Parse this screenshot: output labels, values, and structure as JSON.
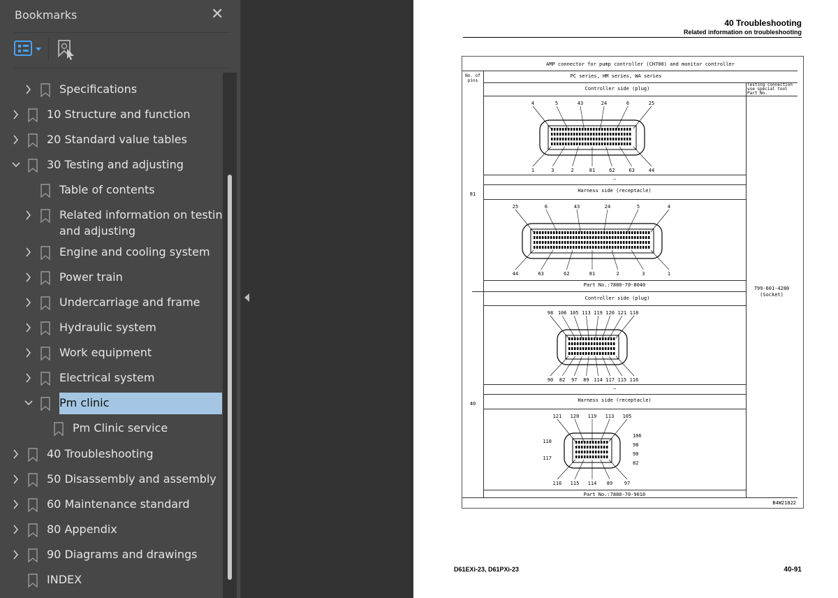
{
  "panel": {
    "title": "Bookmarks",
    "close_icon": "close-icon",
    "toolbar": {
      "options_icon": "list-options-icon",
      "find_icon": "find-current-bookmark-icon"
    }
  },
  "bookmarks": [
    {
      "label": "Specifications",
      "level": 1,
      "expand": "collapsed"
    },
    {
      "label": "10 Structure and function",
      "level": 0,
      "expand": "collapsed"
    },
    {
      "label": "20 Standard value tables",
      "level": 0,
      "expand": "collapsed"
    },
    {
      "label": "30 Testing and adjusting",
      "level": 0,
      "expand": "expanded"
    },
    {
      "label": "Table of contents",
      "level": 1,
      "expand": "none"
    },
    {
      "label": "Related information on testing",
      "label2": "and adjusting",
      "level": 1,
      "expand": "collapsed"
    },
    {
      "label": "Engine and cooling system",
      "level": 1,
      "expand": "collapsed"
    },
    {
      "label": "Power train",
      "level": 1,
      "expand": "collapsed"
    },
    {
      "label": "Undercarriage and frame",
      "level": 1,
      "expand": "collapsed"
    },
    {
      "label": "Hydraulic system",
      "level": 1,
      "expand": "collapsed"
    },
    {
      "label": "Work equipment",
      "level": 1,
      "expand": "collapsed"
    },
    {
      "label": "Electrical system",
      "level": 1,
      "expand": "collapsed"
    },
    {
      "label": "Pm clinic",
      "level": 1,
      "expand": "expanded",
      "selected": true
    },
    {
      "label": "Pm Clinic service",
      "level": 2,
      "expand": "none"
    },
    {
      "label": "40 Troubleshooting",
      "level": 0,
      "expand": "collapsed"
    },
    {
      "label": "50 Disassembly and assembly",
      "level": 0,
      "expand": "collapsed"
    },
    {
      "label": "60 Maintenance standard",
      "level": 0,
      "expand": "collapsed"
    },
    {
      "label": "80 Appendix",
      "level": 0,
      "expand": "collapsed"
    },
    {
      "label": "90 Diagrams and drawings",
      "level": 0,
      "expand": "collapsed"
    },
    {
      "label": "INDEX",
      "level": 0,
      "expand": "none"
    }
  ],
  "page": {
    "header_title": "40 Troubleshooting",
    "header_sub": "Related information on troubleshooting",
    "footer_model": "D61EXi-23, D61PXi-23",
    "footer_page": "40-91",
    "table": {
      "title": "AMP connector for pump controller (CH700) and monitor controller",
      "col_pins": "No. of pins",
      "series": "PC series, HM series, WA series",
      "col_tool": "Testing connection use special tool Part No.",
      "tool_part": "799-601-4280",
      "tool_note": "(Socket)",
      "dash": "—",
      "code": "B4W21822",
      "blocks": [
        {
          "pins": "81",
          "plug_label": "Controller side (plug)",
          "recept_label": "Harness side (receptacle)",
          "part_no": "Part No.:7880-70-8040",
          "plug_top": [
            "4",
            "5",
            "43",
            "24",
            "6",
            "25"
          ],
          "plug_bottom": [
            "1",
            "3",
            "2",
            "81",
            "62",
            "63",
            "44"
          ],
          "rec_top": [
            "25",
            "6",
            "43",
            "24",
            "5",
            "4"
          ],
          "rec_bottom": [
            "44",
            "63",
            "62",
            "81",
            "2",
            "3",
            "1"
          ]
        },
        {
          "pins": "40",
          "plug_label": "Controller side (plug)",
          "recept_label": "Harness side (receptacle)",
          "part_no": "Part No.:7880-70-9010",
          "plug_top": [
            "98",
            "106",
            "105",
            "113",
            "119",
            "120",
            "121",
            "118"
          ],
          "plug_bottom": [
            "90",
            "82",
            "97",
            "89",
            "114",
            "117",
            "115",
            "116"
          ],
          "rec_top": [
            "121",
            "120",
            "119",
            "113",
            "105"
          ],
          "rec_left": [
            "118",
            "117"
          ],
          "rec_right": [
            "106",
            "98",
            "90",
            "82"
          ],
          "rec_bottom": [
            "116",
            "115",
            "114",
            "89",
            "97"
          ]
        }
      ]
    }
  }
}
